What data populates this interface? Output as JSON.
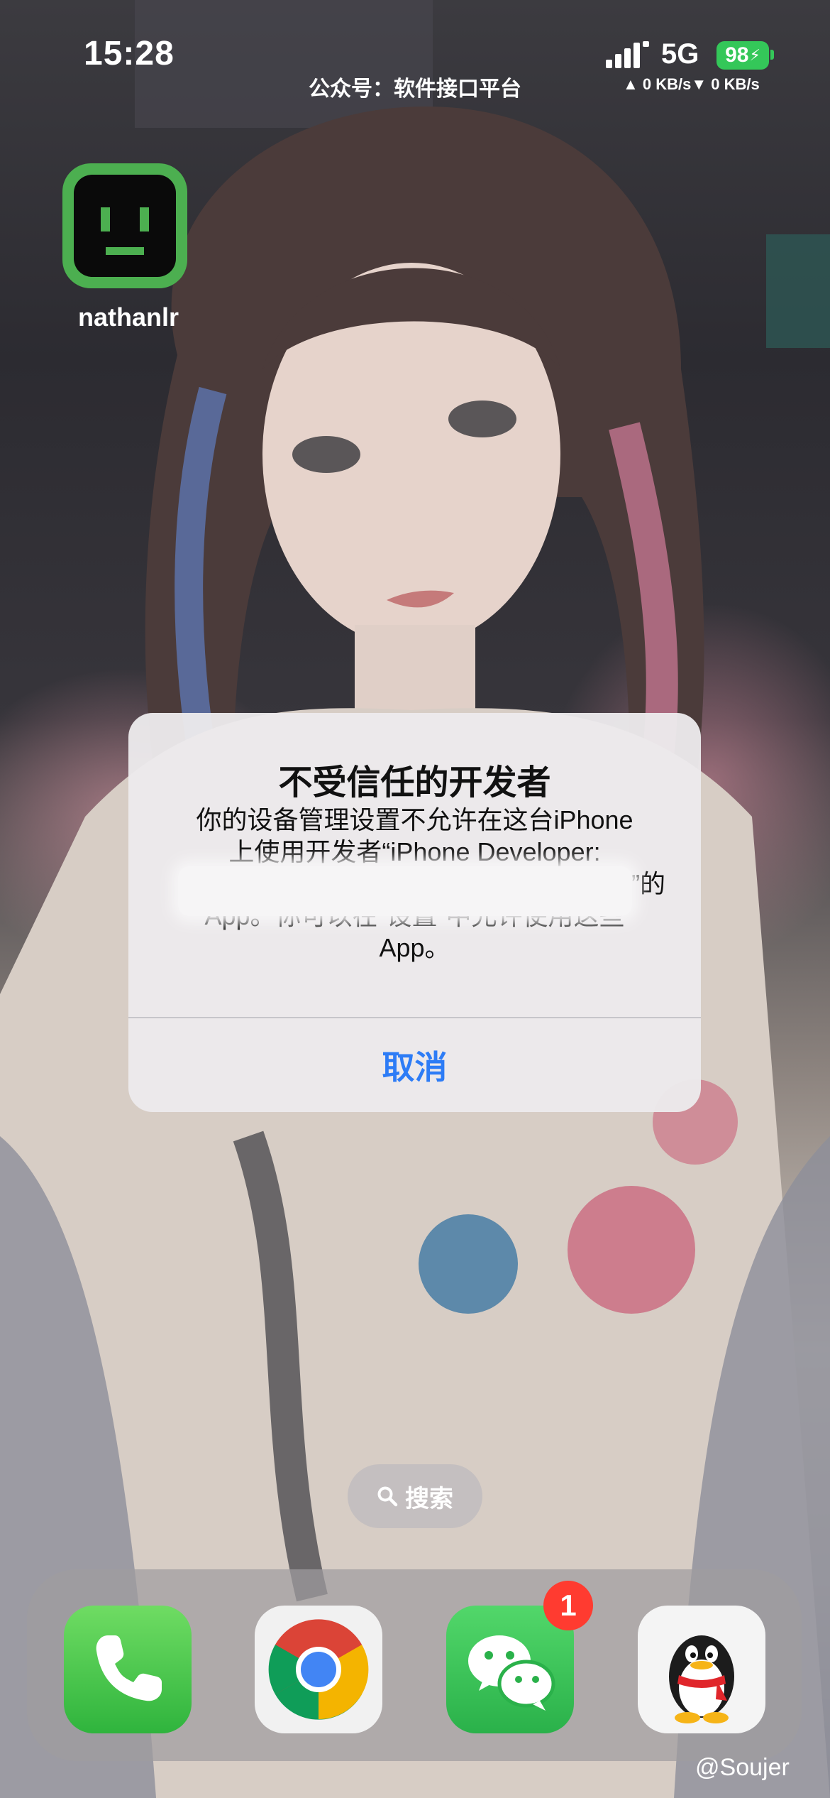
{
  "status_bar": {
    "time": "15:28",
    "network_type": "5G",
    "battery_level": "98",
    "net_speed": "▲ 0 KB/s▼ 0 KB/s",
    "watermark": "公众号：软件接口平台"
  },
  "home": {
    "app_label": "nathanlr"
  },
  "alert": {
    "title": "不受信任的开发者",
    "message_lines": [
      "你的设备管理设置不允许在这台iPhone",
      "上使用开发者“iPhone Developer:",
      "”的",
      "App。你可以在“设置”中允许使用这些",
      "App。"
    ],
    "cancel_label": "取消",
    "cancel_color": "#2d7cf6"
  },
  "search": {
    "label": "搜索"
  },
  "dock": {
    "apps": [
      "phone-icon",
      "chrome-icon",
      "wechat-icon",
      "qq-icon"
    ],
    "wechat_badge": "1"
  },
  "footer": {
    "watermark": "@Soujer"
  }
}
